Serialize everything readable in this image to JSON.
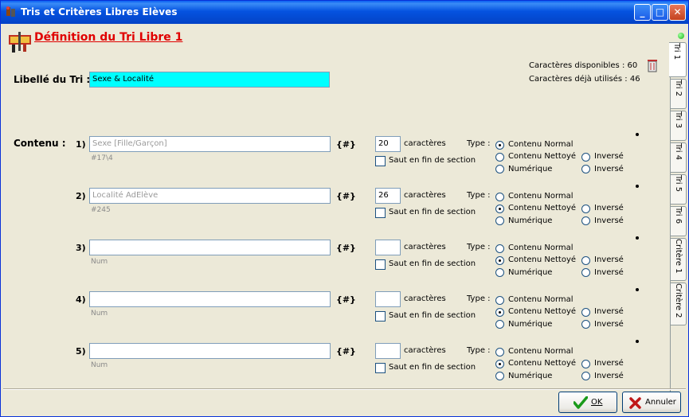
{
  "window": {
    "title": "Tris et Critères Libres Elèves"
  },
  "header": {
    "title": "Définition du Tri Libre 1"
  },
  "counters": {
    "available": "Caractères disponibles : 60",
    "used": "Caractères déjà utilisés : 46"
  },
  "libelle": {
    "label": "Libellé du Tri :",
    "value": "Sexe & Localité"
  },
  "contenu": {
    "label": "Contenu :"
  },
  "common": {
    "hash": "{#}",
    "caracteres": "caractères",
    "type": "Type :",
    "saut": "Saut en fin de section",
    "opt_normal": "Contenu Normal",
    "opt_nettoye": "Contenu Nettoyé",
    "opt_numerique": "Numérique",
    "inverse": "Inversé"
  },
  "rows": [
    {
      "num": "1)",
      "field": "Sexe [Fille/Garçon]",
      "code": "#17\\4",
      "length": "20",
      "type": "normal"
    },
    {
      "num": "2)",
      "field": "Localité AdElève",
      "code": "#245",
      "length": "26",
      "type": "nettoye"
    },
    {
      "num": "3)",
      "field": "",
      "code": "Num",
      "length": "",
      "type": "nettoye"
    },
    {
      "num": "4)",
      "field": "",
      "code": "Num",
      "length": "",
      "type": "nettoye"
    },
    {
      "num": "5)",
      "field": "",
      "code": "Num",
      "length": "",
      "type": "nettoye"
    }
  ],
  "tabs": [
    "Tri 1",
    "Tri 2",
    "Tri 3",
    "Tri 4",
    "Tri 5",
    "Tri 6",
    "Critère 1",
    "Critère 2"
  ],
  "buttons": {
    "ok": "OK",
    "cancel": "Annuler"
  }
}
